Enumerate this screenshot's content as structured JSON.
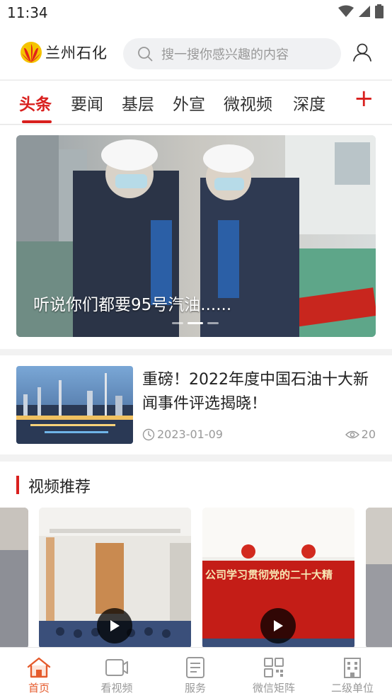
{
  "status_bar": {
    "time": "11:34"
  },
  "header": {
    "app_name": "兰州石化",
    "search_placeholder": "搜一搜你感兴趣的内容"
  },
  "tabs": [
    {
      "label": "头条",
      "active": true
    },
    {
      "label": "要闻"
    },
    {
      "label": "基层"
    },
    {
      "label": "外宣"
    },
    {
      "label": "微视频"
    },
    {
      "label": "深度"
    }
  ],
  "tab_add_symbol": "+",
  "banner": {
    "caption": "听说你们都要95号汽油......",
    "slide_count": 3,
    "active_slide": 2
  },
  "news": [
    {
      "title": "重磅！2022年度中国石油十大新闻事件评选揭晓！",
      "date": "2023-01-09",
      "views": "20"
    }
  ],
  "video_section": {
    "title": "视频推荐",
    "banner_text": "公司学习贯彻党的二十大精"
  },
  "bottom_nav": [
    {
      "label": "首页",
      "icon": "home-icon",
      "active": true
    },
    {
      "label": "看视频",
      "icon": "video-icon"
    },
    {
      "label": "服务",
      "icon": "document-icon"
    },
    {
      "label": "微信矩阵",
      "icon": "qr-code-icon"
    },
    {
      "label": "二级单位",
      "icon": "building-icon"
    }
  ],
  "colors": {
    "accent": "#d9201e",
    "nav_active": "#e55a2b",
    "muted": "#999999"
  }
}
